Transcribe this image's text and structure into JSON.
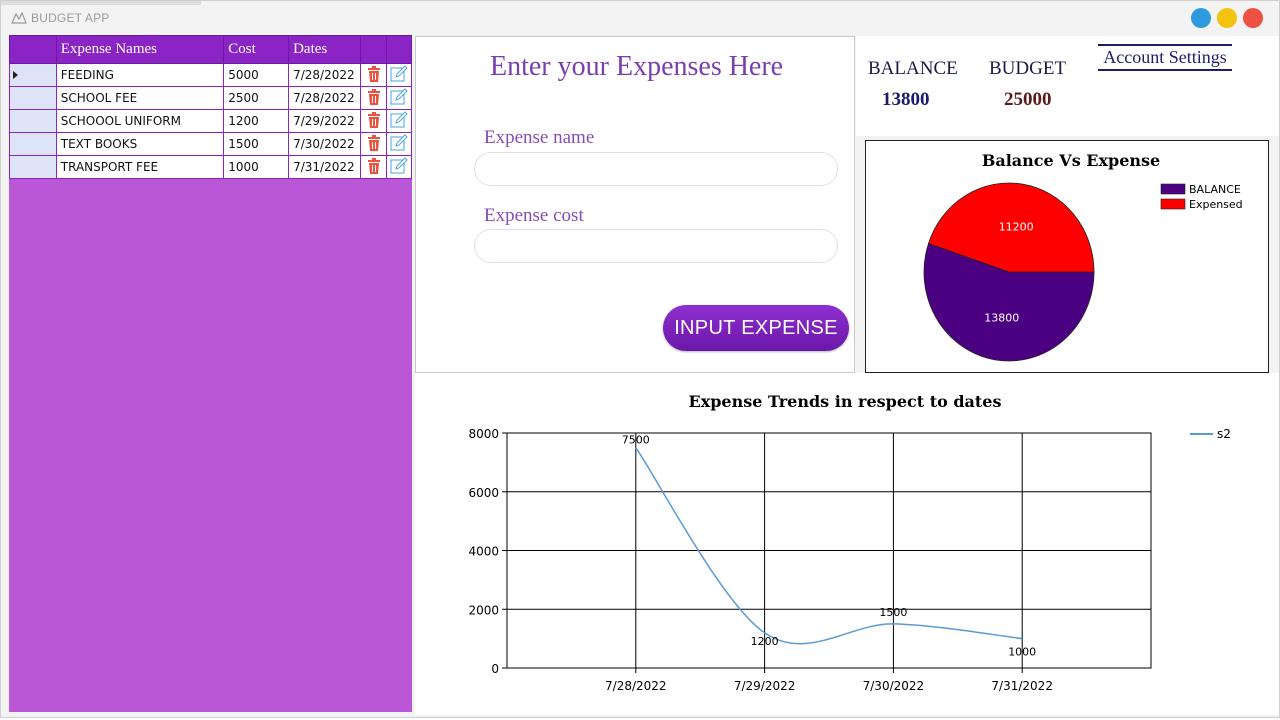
{
  "window": {
    "title": "BUDGET APP",
    "buttons": [
      {
        "name": "minimize",
        "color": "#2e9be0"
      },
      {
        "name": "maximize",
        "color": "#f2c40f"
      },
      {
        "name": "close",
        "color": "#ee5144"
      }
    ]
  },
  "grid": {
    "columns": [
      "Expense Names",
      "Cost",
      "Dates"
    ],
    "rows": [
      {
        "name": "FEEDING",
        "cost": "5000",
        "date": "7/28/2022",
        "selected": true
      },
      {
        "name": "SCHOOL FEE",
        "cost": "2500",
        "date": "7/28/2022",
        "selected": false
      },
      {
        "name": "SCHOOOL UNIFORM",
        "cost": "1200",
        "date": "7/29/2022",
        "selected": false
      },
      {
        "name": "TEXT BOOKS",
        "cost": "1500",
        "date": "7/30/2022",
        "selected": false
      },
      {
        "name": "TRANSPORT FEE",
        "cost": "1000",
        "date": "7/31/2022",
        "selected": false
      }
    ],
    "row_icons": [
      "trash-icon",
      "edit-icon"
    ],
    "colors": {
      "header": "#8a24c4",
      "panel": "#b957d6",
      "delete": "#e8543f",
      "edit": "#4aa6d8"
    }
  },
  "form": {
    "title": "Enter your Expenses Here",
    "name_label": "Expense name",
    "name_value": "",
    "cost_label": "Expense cost",
    "cost_value": "",
    "submit_label": "INPUT EXPENSE"
  },
  "summary": {
    "balance_label": "BALANCE",
    "balance_value": "13800",
    "budget_label": "BUDGET",
    "budget_value": "25000",
    "account_settings_label": "Account Settings"
  },
  "chart_data": [
    {
      "type": "pie",
      "title": "Balance Vs Expense",
      "legend_position": "top-right",
      "slices": [
        {
          "label": "BALANCE",
          "value": 13800,
          "color": "#4b0082",
          "data_label": "13800"
        },
        {
          "label": "Expensed",
          "value": 11200,
          "color": "#ff0000",
          "data_label": "11200"
        }
      ]
    },
    {
      "type": "line",
      "title": "Expense Trends in respect to dates",
      "legend_position": "top-right",
      "grid": true,
      "smooth": true,
      "x": [
        "7/28/2022",
        "7/29/2022",
        "7/30/2022",
        "7/31/2022"
      ],
      "ylim": [
        0,
        8000
      ],
      "y_ticks": [
        0,
        2000,
        4000,
        6000,
        8000
      ],
      "series": [
        {
          "name": "s2",
          "color": "#5b9bd5",
          "values": [
            7500,
            1200,
            1500,
            1000
          ],
          "data_labels": [
            "7500",
            "1200",
            "1500",
            "1000"
          ]
        }
      ]
    }
  ]
}
